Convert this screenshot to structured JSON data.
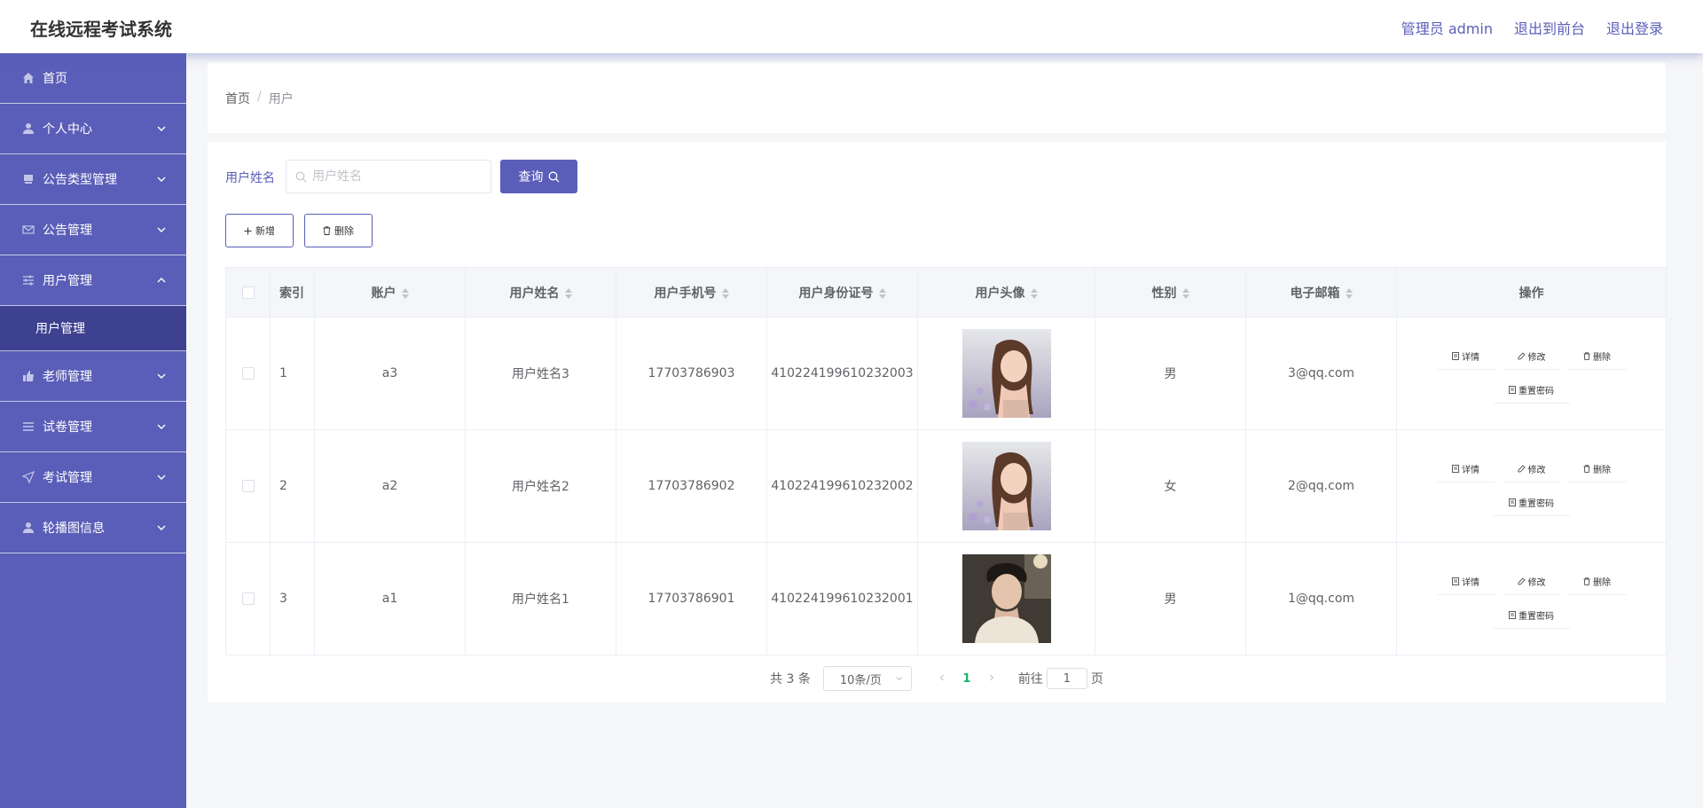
{
  "header": {
    "title": "在线远程考试系统",
    "admin": "管理员 admin",
    "to_front": "退出到前台",
    "logout": "退出登录"
  },
  "sidebar": {
    "items": [
      {
        "label": "首页",
        "icon": "home-icon"
      },
      {
        "label": "个人中心",
        "icon": "user-icon"
      },
      {
        "label": "公告类型管理",
        "icon": "box-icon"
      },
      {
        "label": "公告管理",
        "icon": "mail-icon"
      },
      {
        "label": "用户管理",
        "icon": "sliders-icon",
        "expanded": true
      },
      {
        "label": "老师管理",
        "icon": "thumb-icon"
      },
      {
        "label": "试卷管理",
        "icon": "list-icon"
      },
      {
        "label": "考试管理",
        "icon": "send-icon"
      },
      {
        "label": "轮播图信息",
        "icon": "user-icon"
      }
    ],
    "submenu": "用户管理"
  },
  "breadcrumb": {
    "home": "首页",
    "sep": "/",
    "current": "用户"
  },
  "search": {
    "label": "用户姓名",
    "placeholder": "用户姓名",
    "value": "",
    "button": "查询"
  },
  "actions": {
    "add": "新增",
    "delete": "删除"
  },
  "table": {
    "headers": [
      "索引",
      "账户",
      "用户姓名",
      "用户手机号",
      "用户身份证号",
      "用户头像",
      "性别",
      "电子邮箱",
      "操作"
    ],
    "rows": [
      {
        "index": "1",
        "account": "a3",
        "name": "用户姓名3",
        "phone": "17703786903",
        "idcard": "410224199610232003",
        "avatar": "girl",
        "gender": "男",
        "email": "3@qq.com"
      },
      {
        "index": "2",
        "account": "a2",
        "name": "用户姓名2",
        "phone": "17703786902",
        "idcard": "410224199610232002",
        "avatar": "girl",
        "gender": "女",
        "email": "2@qq.com"
      },
      {
        "index": "3",
        "account": "a1",
        "name": "用户姓名1",
        "phone": "17703786901",
        "idcard": "410224199610232001",
        "avatar": "boy",
        "gender": "男",
        "email": "1@qq.com"
      }
    ],
    "ops": {
      "detail": "详情",
      "edit": "修改",
      "delete": "删除",
      "reset": "重置密码"
    }
  },
  "pagination": {
    "total": "共 3 条",
    "page_size": "10条/页",
    "current": "1",
    "goto_label": "前往",
    "goto_value": "1",
    "page_unit": "页"
  },
  "colors": {
    "primary": "#5a5eb8",
    "submenu_bg": "#3e4190",
    "page_active": "#17b26a"
  }
}
